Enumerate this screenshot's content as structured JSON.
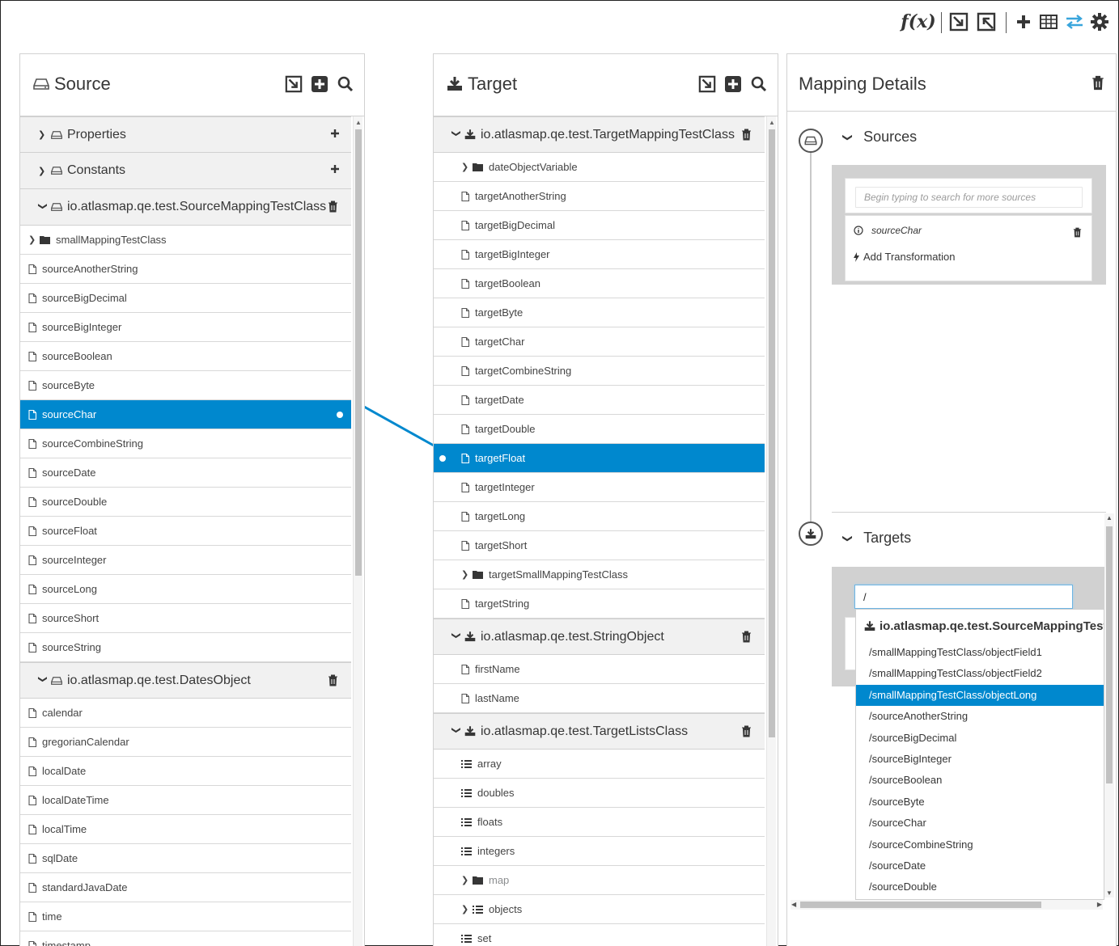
{
  "toolbar": {
    "function_icon": "f(x)",
    "buttons": [
      "function-icon",
      "import-icon",
      "export-icon",
      "plus-icon",
      "table-icon",
      "exchange-icon",
      "gear-icon"
    ],
    "active_color": "#39a5dc"
  },
  "source": {
    "title": "Source",
    "docs": [
      {
        "label": "Properties",
        "collapsed": true
      },
      {
        "label": "Constants",
        "collapsed": true
      },
      {
        "label": "io.atlasmap.qe.test.SourceMappingTestClass",
        "collapsed": false
      }
    ],
    "fields": [
      "smallMappingTestClass",
      "sourceAnotherString",
      "sourceBigDecimal",
      "sourceBigInteger",
      "sourceBoolean",
      "sourceByte",
      "sourceChar",
      "sourceCombineString",
      "sourceDate",
      "sourceDouble",
      "sourceFloat",
      "sourceInteger",
      "sourceLong",
      "sourceShort",
      "sourceString"
    ],
    "dates_doc": "io.atlasmap.qe.test.DatesObject",
    "dates_fields": [
      "calendar",
      "gregorianCalendar",
      "localDate",
      "localDateTime",
      "localTime",
      "sqlDate",
      "standardJavaDate",
      "time",
      "timestamp"
    ]
  },
  "target": {
    "title": "Target",
    "doc1": "io.atlasmap.qe.test.TargetMappingTestClass",
    "doc1_fields": [
      "dateObjectVariable",
      "targetAnotherString",
      "targetBigDecimal",
      "targetBigInteger",
      "targetBoolean",
      "targetByte",
      "targetChar",
      "targetCombineString",
      "targetDate",
      "targetDouble",
      "targetFloat",
      "targetInteger",
      "targetLong",
      "targetShort",
      "targetSmallMappingTestClass",
      "targetString"
    ],
    "doc2": "io.atlasmap.qe.test.StringObject",
    "doc2_fields": [
      "firstName",
      "lastName"
    ],
    "doc3": "io.atlasmap.qe.test.TargetListsClass",
    "doc3_fields": [
      "array",
      "doubles",
      "floats",
      "integers",
      "map",
      "objects",
      "set"
    ]
  },
  "mapping": {
    "title": "Mapping Details",
    "sources_label": "Sources",
    "sources_placeholder": "Begin typing to search for more sources",
    "source_field": "sourceChar",
    "add_transformation": "Add Transformation",
    "targets_label": "Targets",
    "target_input_value": "/",
    "dropdown_header": "io.atlasmap.qe.test.SourceMappingTestClass",
    "dropdown_items": [
      "/smallMappingTestClass/objectField1",
      "/smallMappingTestClass/objectField2",
      "/smallMappingTestClass/objectLong",
      "/sourceAnotherString",
      "/sourceBigDecimal",
      "/sourceBigInteger",
      "/sourceBoolean",
      "/sourceByte",
      "/sourceChar",
      "/sourceCombineString",
      "/sourceDate",
      "/sourceDouble"
    ],
    "dropdown_highlight_index": 2
  },
  "colors": {
    "selected": "#0088ce",
    "line": "#0088ce"
  }
}
